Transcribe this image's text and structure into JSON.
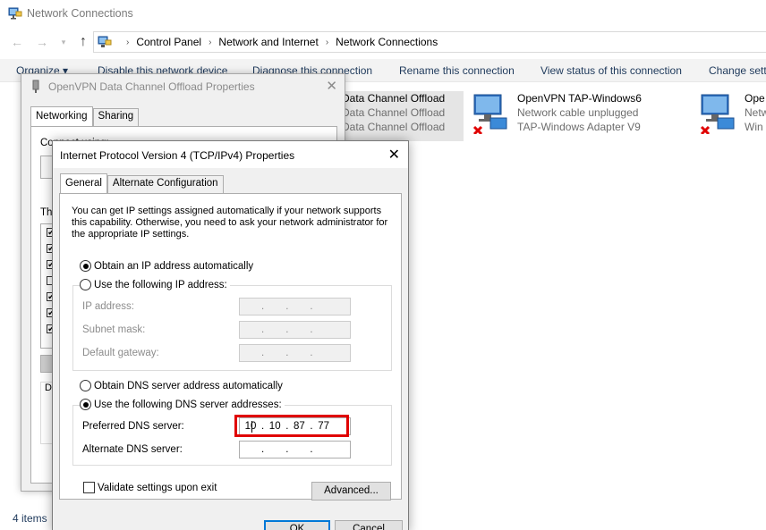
{
  "window": {
    "title": "Network Connections"
  },
  "breadcrumb": [
    "Control Panel",
    "Network and Internet",
    "Network Connections"
  ],
  "commands": [
    "Organize ▾",
    "Disable this network device",
    "Diagnose this connection",
    "Rename this connection",
    "View status of this connection",
    "Change setti"
  ],
  "adapters": [
    {
      "name": "Data Channel Offload",
      "status": "Data Channel Offload",
      "device": "Data Channel Offload"
    },
    {
      "name": "OpenVPN TAP-Windows6",
      "status": "Network cable unplugged",
      "device": "TAP-Windows Adapter V9"
    },
    {
      "name": "Ope",
      "status": "Netw",
      "device": "Win"
    }
  ],
  "status_bar": "4 items",
  "openvpn_dialog": {
    "title": "OpenVPN Data Channel Offload Properties",
    "tabs": [
      "Networking",
      "Sharing"
    ],
    "connect_using_label": "Connect using:",
    "this_label": "Th",
    "desc_label": "D"
  },
  "ipv4_dialog": {
    "title": "Internet Protocol Version 4 (TCP/IPv4) Properties",
    "tabs": [
      "General",
      "Alternate Configuration"
    ],
    "intro": "You can get IP settings assigned automatically if your network supports this capability. Otherwise, you need to ask your network administrator for the appropriate IP settings.",
    "obtain_ip_auto": "Obtain an IP address automatically",
    "use_following_ip": "Use the following IP address:",
    "ip_address_label": "IP address:",
    "subnet_mask_label": "Subnet mask:",
    "default_gateway_label": "Default gateway:",
    "obtain_dns_auto": "Obtain DNS server address automatically",
    "use_following_dns": "Use the following DNS server addresses:",
    "preferred_dns_label": "Preferred DNS server:",
    "alternate_dns_label": "Alternate DNS server:",
    "preferred_dns": [
      "10",
      "10",
      "87",
      "77"
    ],
    "validate_label": "Validate settings upon exit",
    "advanced_label": "Advanced...",
    "ok_label": "OK",
    "cancel_label": "Cancel"
  }
}
